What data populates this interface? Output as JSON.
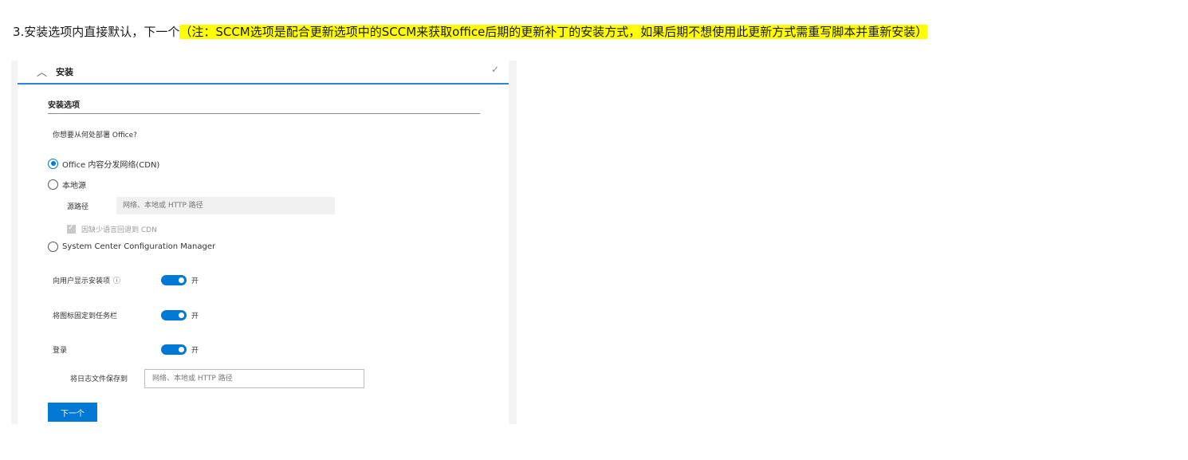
{
  "instruction": {
    "prefix": "3.安装选项内直接默认，下一个",
    "note": "（注：SCCM选项是配合更新选项中的SCCM来获取office后期的更新补丁的安装方式，如果后期不想使用此更新方式需重写脚本并重新安装）"
  },
  "panel": {
    "header": {
      "title": "安装",
      "chevron_icon": "chevron-up-icon",
      "check_icon": "checkmark-icon"
    },
    "section_title": "安装选项",
    "question": "你想要从何处部署 Office?",
    "deploy_options": [
      {
        "label": "Office 内容分发网络(CDN)",
        "checked": true
      },
      {
        "label": "本地源",
        "checked": false
      },
      {
        "label": "System Center Configuration Manager",
        "checked": false
      }
    ],
    "source_path": {
      "label": "源路径",
      "placeholder": "网络、本地或 HTTP 路径"
    },
    "fallback_cdn": {
      "label": "因缺少语言回退到 CDN",
      "checked": true,
      "disabled": true
    },
    "toggles": [
      {
        "label": "向用户显示安装项",
        "state": "开",
        "on": true,
        "info_icon": "info-icon"
      },
      {
        "label": "将图标固定到任务栏",
        "state": "开",
        "on": true
      },
      {
        "label": "登录",
        "state": "开",
        "on": true
      }
    ],
    "log_path": {
      "label": "将日志文件保存到",
      "placeholder": "网络、本地或 HTTP 路径"
    },
    "next_button": "下一个",
    "colors": {
      "accent": "#0078d4",
      "highlight": "#ffff00"
    }
  }
}
